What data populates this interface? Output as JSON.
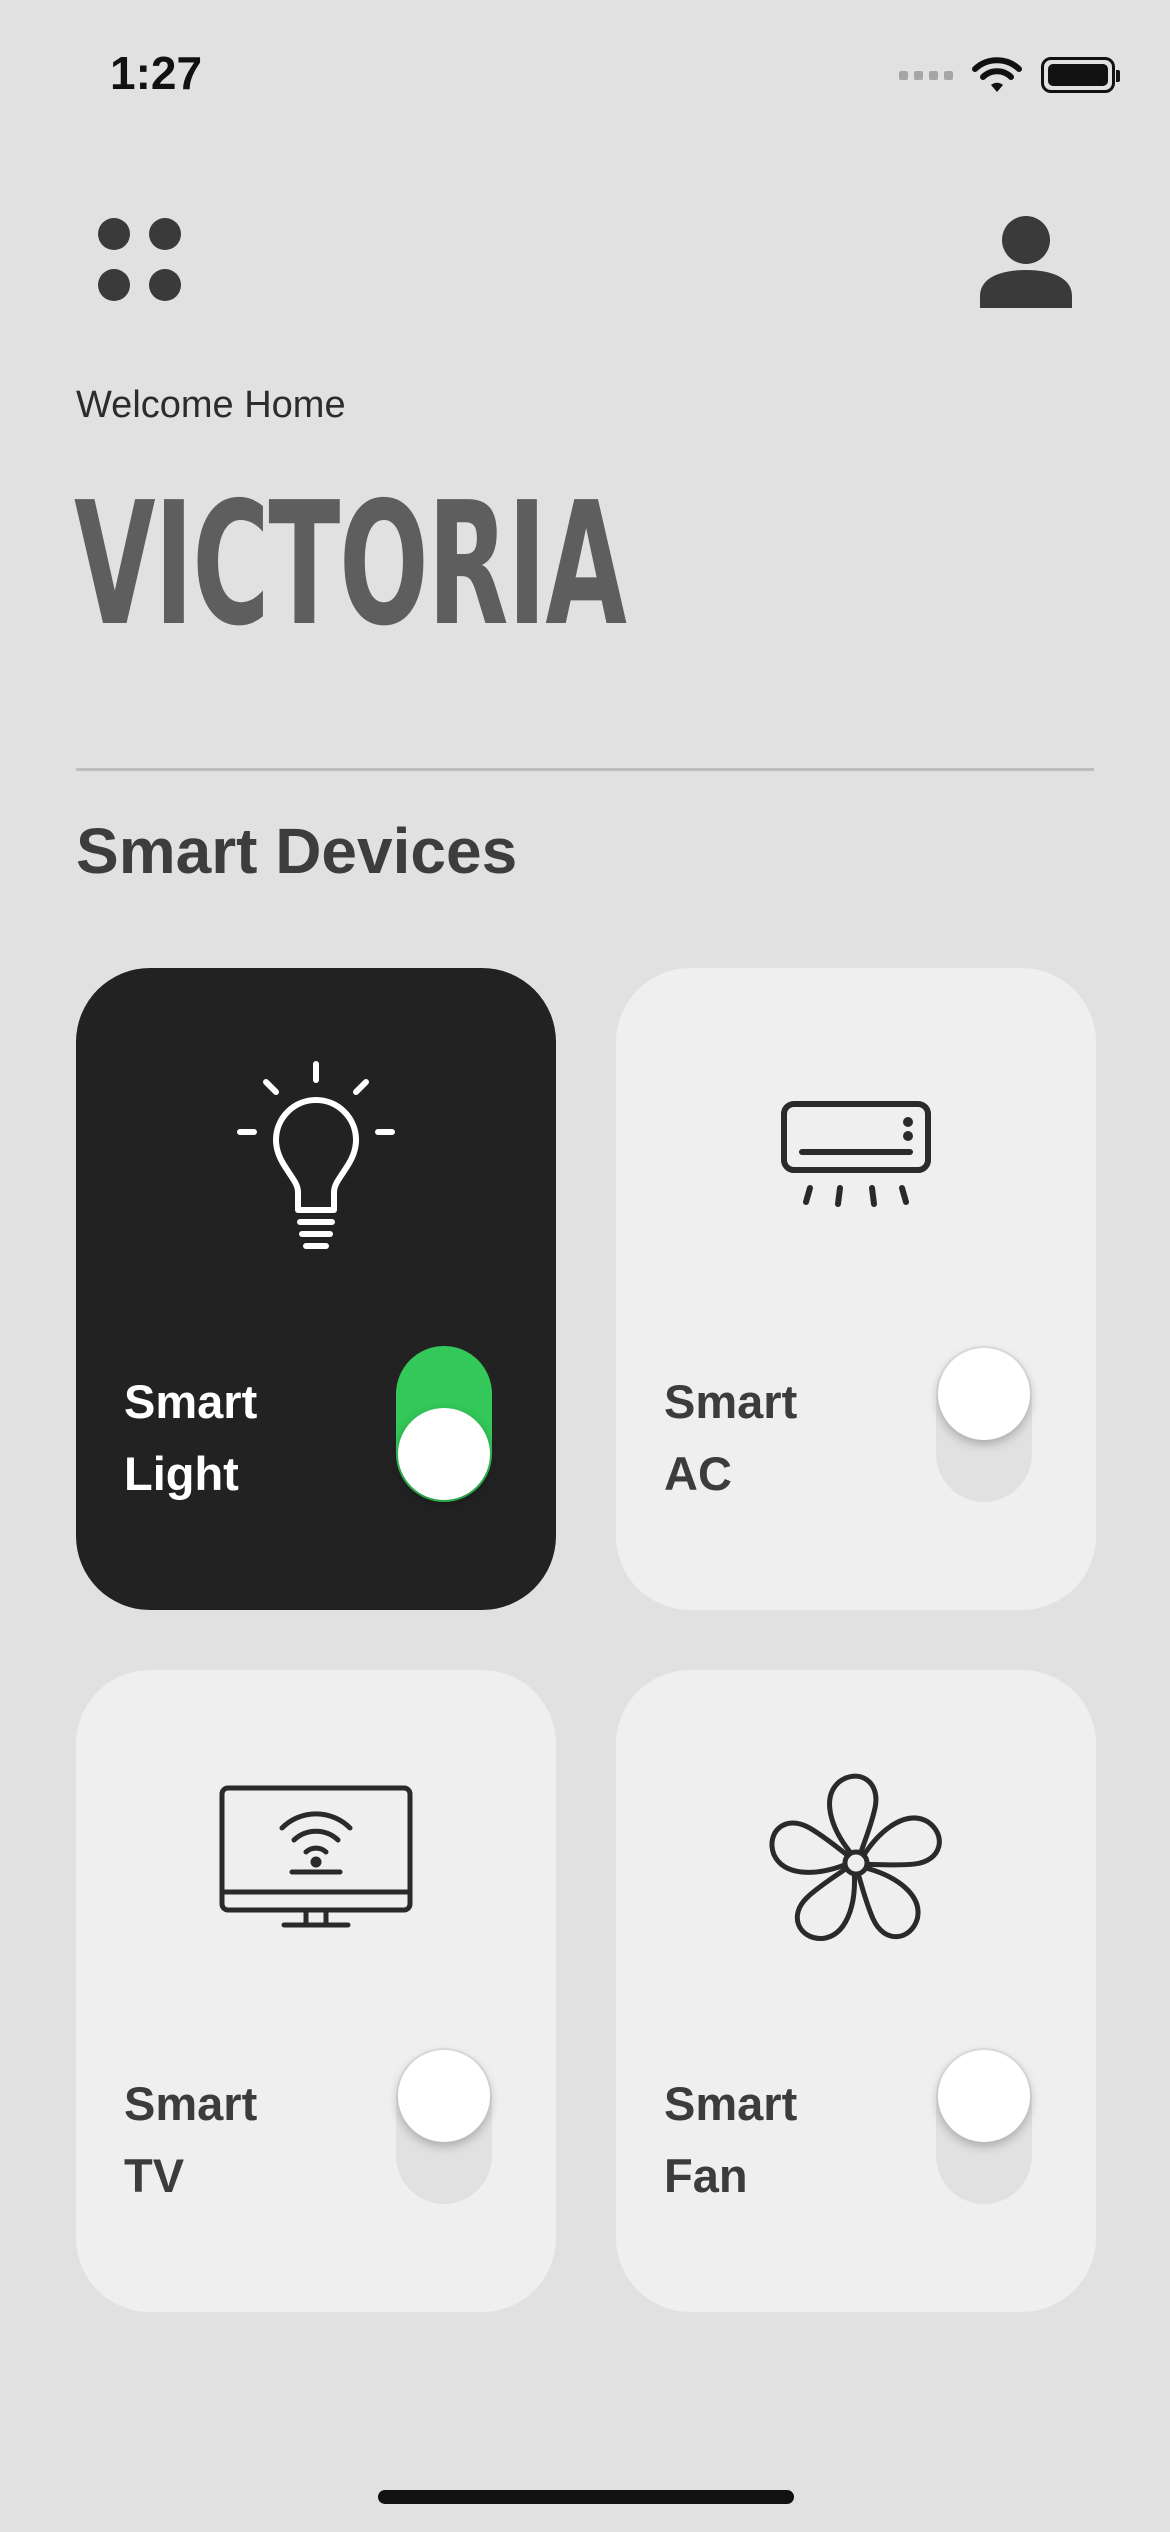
{
  "status_bar": {
    "time": "1:27"
  },
  "header": {
    "welcome": "Welcome Home",
    "name": "VICTORIA",
    "menu_icon": "grid-dots-icon",
    "profile_icon": "user-icon"
  },
  "section": {
    "title": "Smart Devices"
  },
  "devices": [
    {
      "line1": "Smart",
      "line2": "Light",
      "icon": "lightbulb-icon",
      "on": true
    },
    {
      "line1": "Smart",
      "line2": "AC",
      "icon": "air-conditioner-icon",
      "on": false
    },
    {
      "line1": "Smart",
      "line2": "TV",
      "icon": "smart-tv-icon",
      "on": false
    },
    {
      "line1": "Smart",
      "line2": "Fan",
      "icon": "fan-icon",
      "on": false
    }
  ],
  "colors": {
    "background": "#e1e1e1",
    "card": "#efefef",
    "card_active": "#222222",
    "toggle_on": "#34c759",
    "name_text": "#5e5e5e"
  }
}
